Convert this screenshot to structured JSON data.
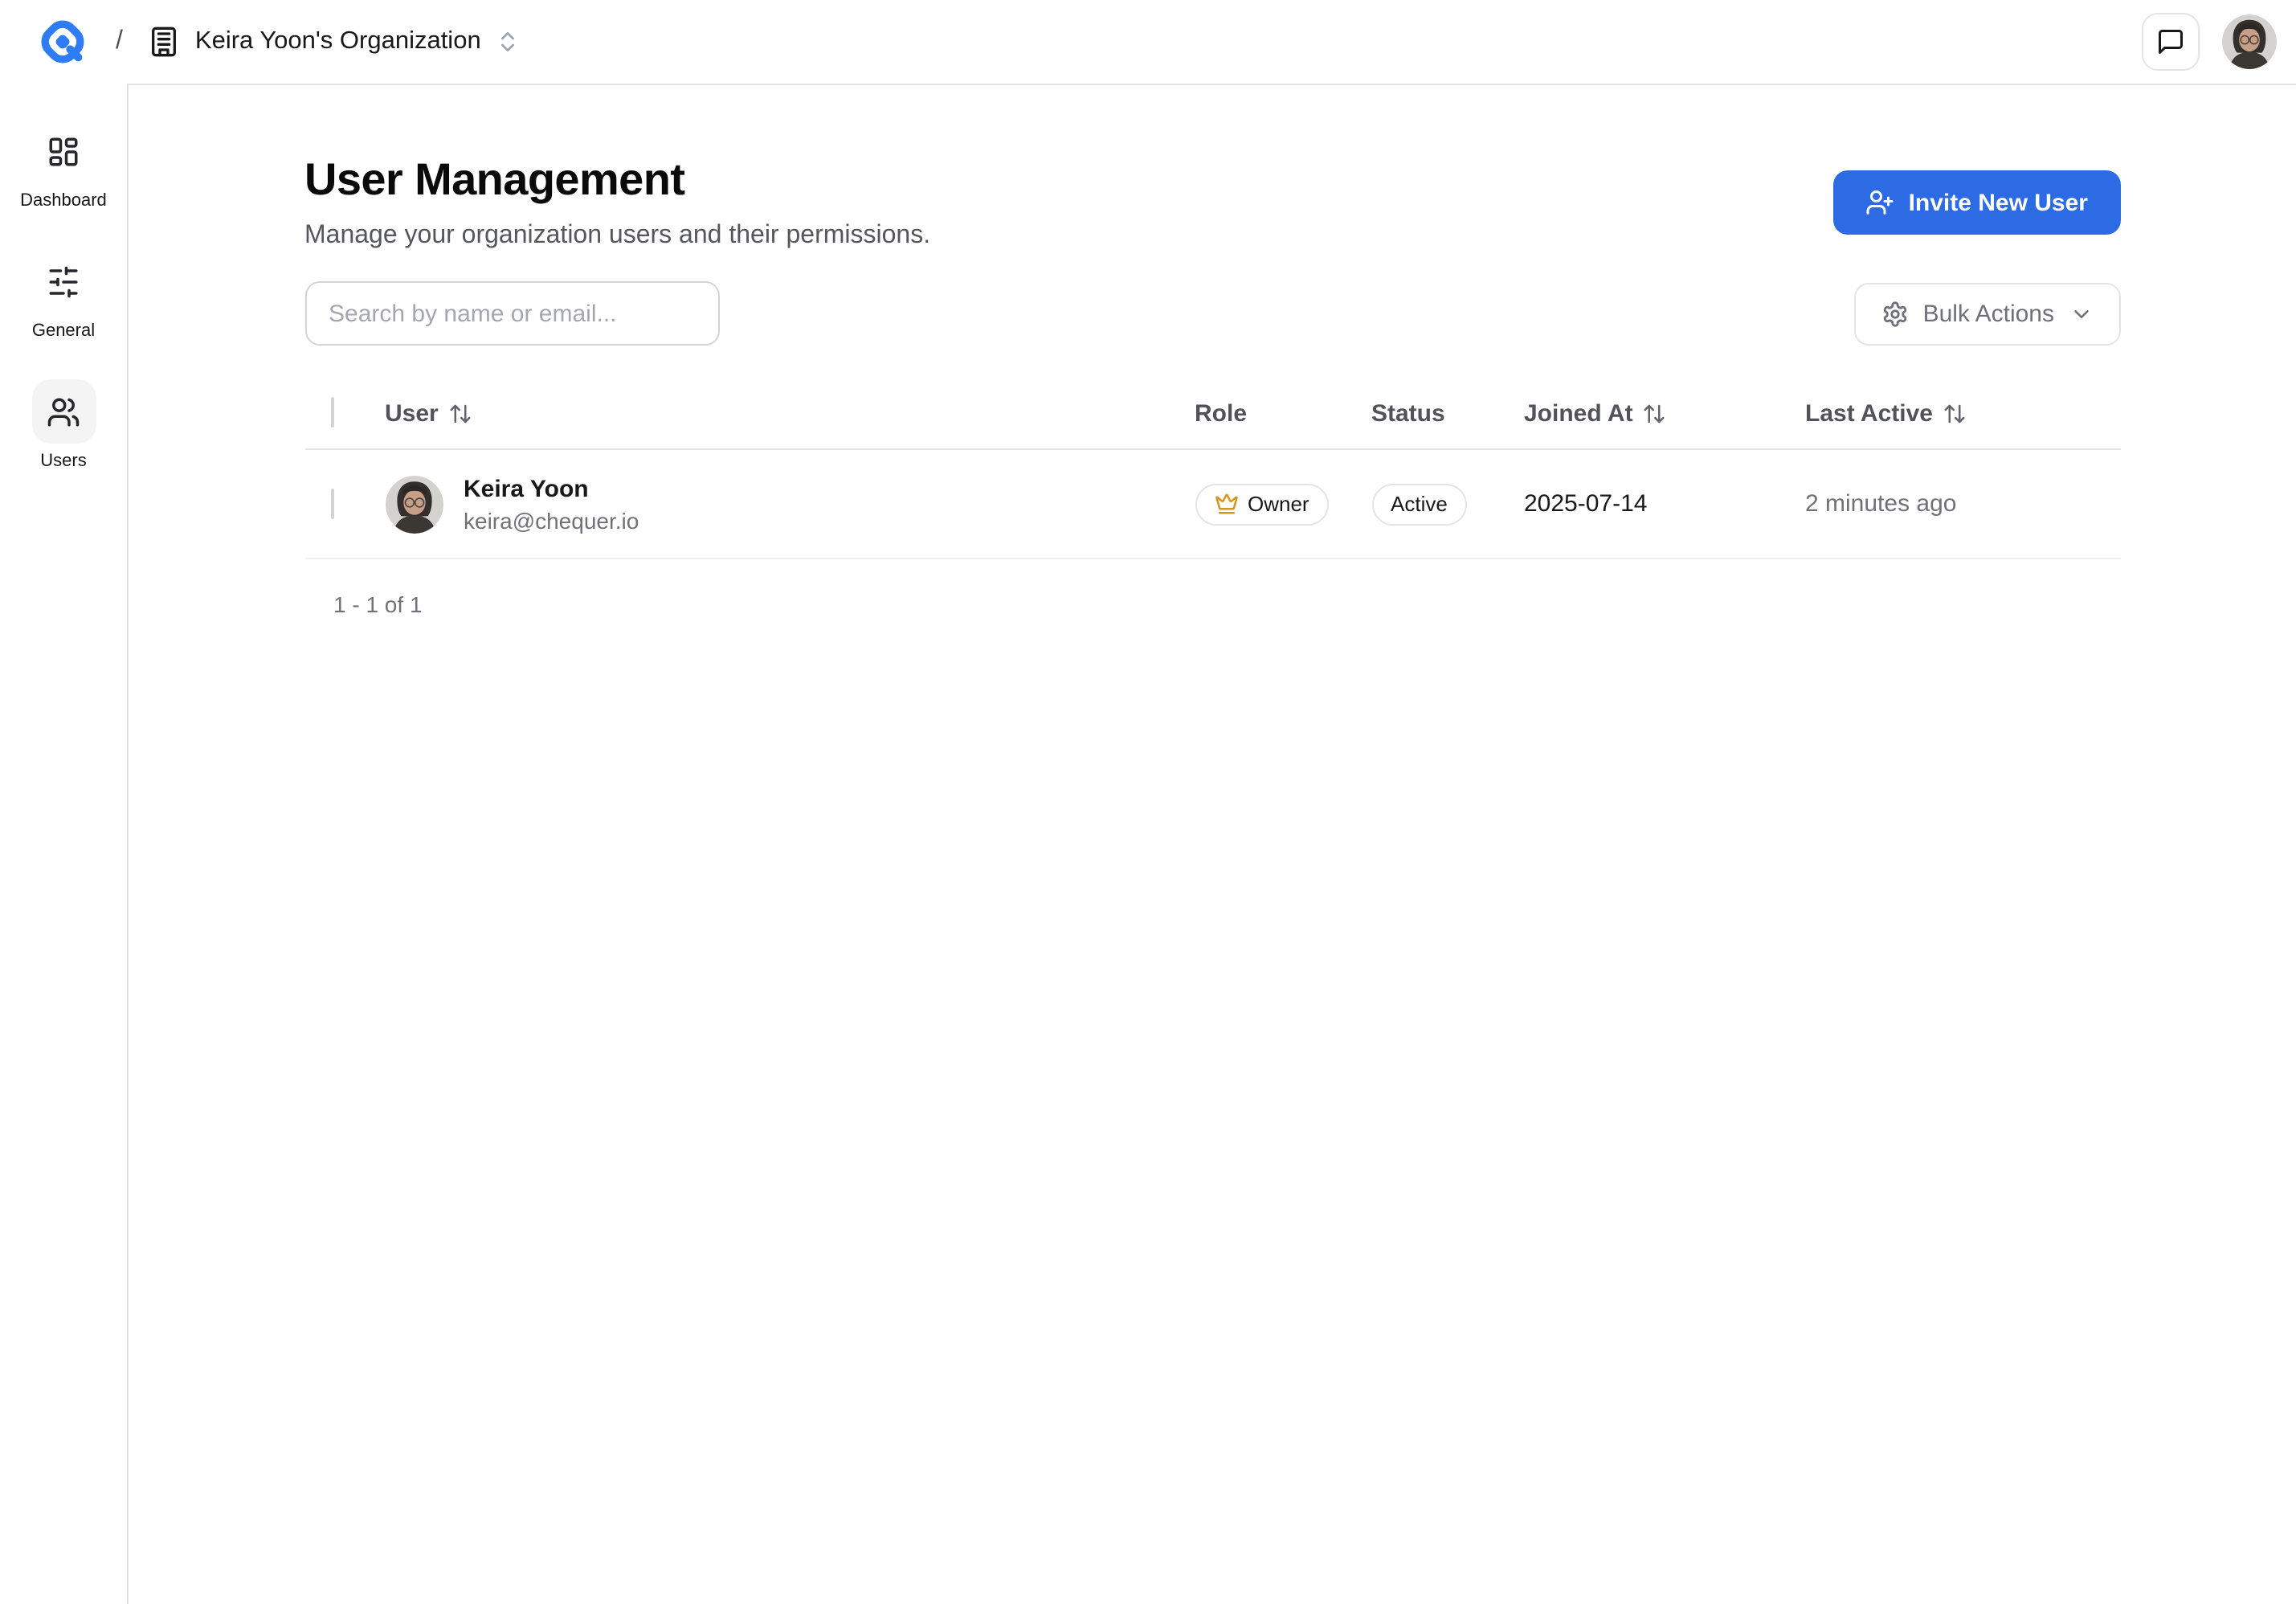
{
  "colors": {
    "accent": "#2d6be4",
    "logo": "#2e7cf6",
    "crown": "#d7941f"
  },
  "topbar": {
    "breadcrumb_separator": "/",
    "org_name": "Keira Yoon's Organization",
    "icons": [
      "logo",
      "building-icon",
      "chevrons-up-down-icon",
      "chat-bubble-icon",
      "user-avatar"
    ]
  },
  "sidebar": {
    "items": [
      {
        "label": "Dashboard",
        "icon": "dashboard-grid-icon",
        "active": false
      },
      {
        "label": "General",
        "icon": "sliders-icon",
        "active": false
      },
      {
        "label": "Users",
        "icon": "users-icon",
        "active": true
      }
    ]
  },
  "page": {
    "title": "User Management",
    "subtitle": "Manage your organization users and their permissions.",
    "invite_button_label": "Invite New User",
    "search_placeholder": "Search by name or email...",
    "bulk_actions_label": "Bulk Actions"
  },
  "table": {
    "headers": {
      "user": "User",
      "role": "Role",
      "status": "Status",
      "joined": "Joined At",
      "last_active": "Last Active"
    },
    "rows": [
      {
        "name": "Keira Yoon",
        "email": "keira@chequer.io",
        "role": "Owner",
        "status": "Active",
        "joined": "2025-07-14",
        "last_active": "2 minutes ago"
      }
    ],
    "pagination": "1 - 1 of 1"
  }
}
